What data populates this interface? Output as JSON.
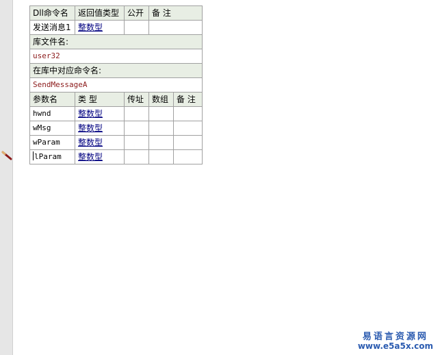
{
  "dll_header": {
    "name_col": "Dll命令名",
    "return_type_col": "返回值类型",
    "public_col": "公开",
    "remark_col": "备 注"
  },
  "dll_command": {
    "name": "发送消息1",
    "return_type": "整数型",
    "public": "",
    "remark": ""
  },
  "library": {
    "label": "库文件名:",
    "value": "user32"
  },
  "entry": {
    "label": "在库中对应命令名:",
    "value": "SendMessageA"
  },
  "param_header": {
    "name_col": "参数名",
    "type_col": "类 型",
    "byref_col": "传址",
    "array_col": "数组",
    "remark_col": "备 注"
  },
  "params": [
    {
      "name": "hwnd",
      "type": "整数型"
    },
    {
      "name": "wMsg",
      "type": "整数型"
    },
    {
      "name": "wParam",
      "type": "整数型"
    },
    {
      "name": "lParam",
      "type": "整数型"
    }
  ],
  "watermark": {
    "title": "易语言资源网",
    "url": "www.e5a5x.com"
  },
  "colors": {
    "header_bg": "#e8eee4",
    "value_red": "#8b1a1a",
    "type_link": "#000080",
    "watermark": "#2b5bb0"
  }
}
